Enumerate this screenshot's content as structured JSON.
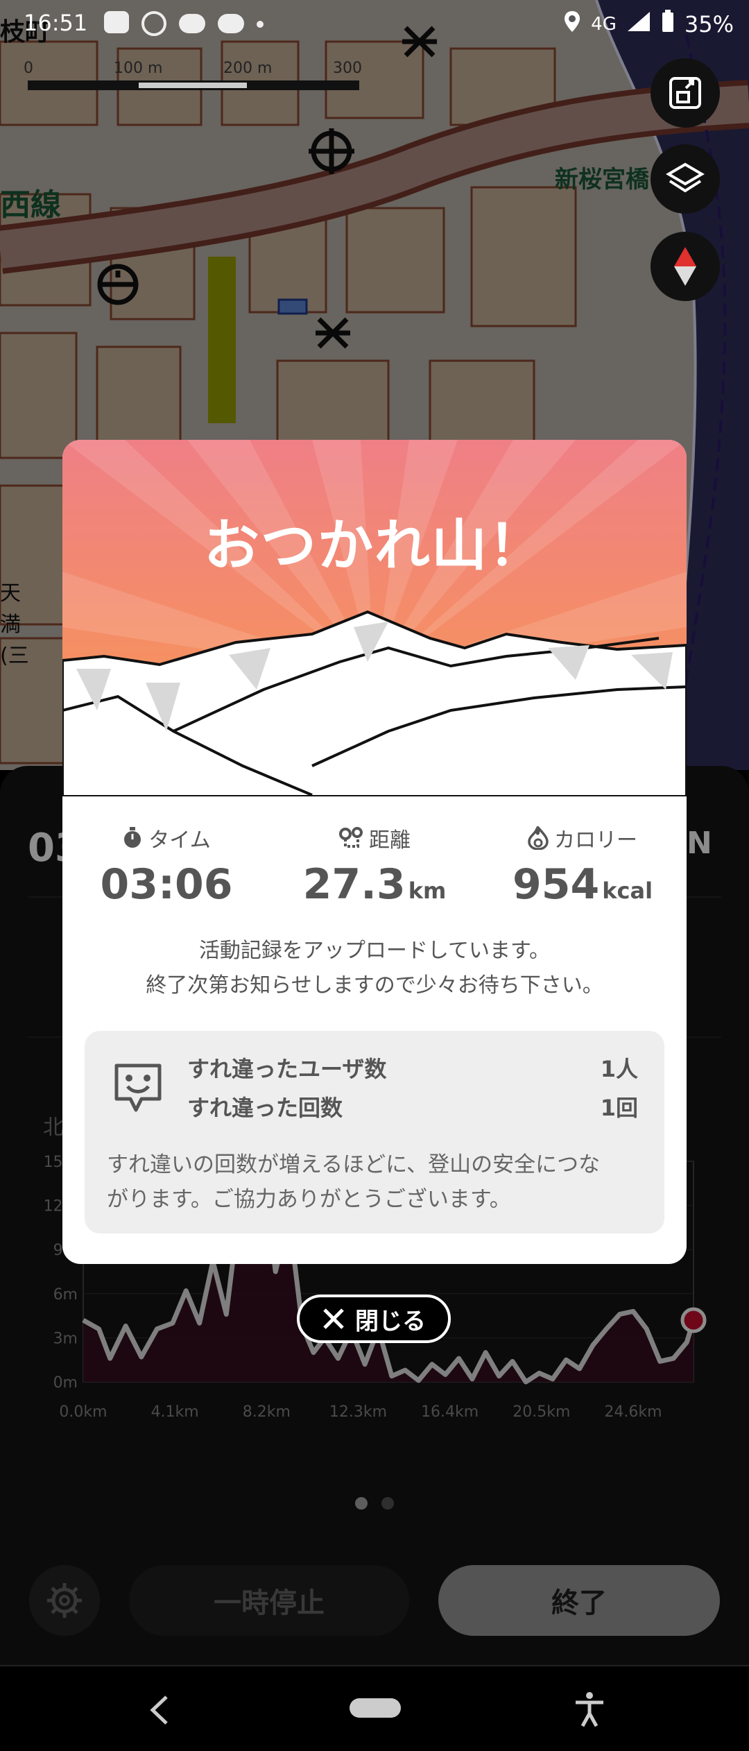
{
  "status_bar": {
    "time": "16:51",
    "network": "4G",
    "battery": "35%",
    "notification_icons": [
      "line-icon",
      "media-icon",
      "weather-icon",
      "cloud-icon",
      "dot-icon"
    ],
    "right_icons": [
      "location-icon",
      "signal-icon",
      "battery-icon"
    ]
  },
  "map": {
    "labels": {
      "top_left": "枝町",
      "line_name": "西線",
      "station": "新桜宮橋",
      "left_vertical_1": "天",
      "left_vertical_2": "満",
      "left_vertical_3": "(三"
    },
    "scale_labels": [
      "0",
      "100 m",
      "200 m",
      "300 m"
    ],
    "buttons": [
      "fit-route-icon",
      "layers-icon",
      "compass-icon"
    ]
  },
  "panel": {
    "left_partial": "03",
    "right_partial": "N",
    "chart_label_partial": "北"
  },
  "chart_data": {
    "type": "area",
    "x_ticks": [
      "0.0km",
      "4.1km",
      "8.2km",
      "12.3km",
      "16.4km",
      "20.5km",
      "24.6km"
    ],
    "y_ticks": [
      "0m",
      "3m",
      "6m",
      "9m",
      "12m",
      "15m"
    ],
    "ylim": [
      0,
      15
    ],
    "xlim": [
      0,
      27.3
    ],
    "x": [
      0,
      0.7,
      1.2,
      1.9,
      2.6,
      3.3,
      4.0,
      4.6,
      5.2,
      5.8,
      6.4,
      7.0,
      7.6,
      8.2,
      8.6,
      9.2,
      9.8,
      10.3,
      10.8,
      11.4,
      12.0,
      12.6,
      13.2,
      13.8,
      14.4,
      15.0,
      15.6,
      16.2,
      16.8,
      17.4,
      18.0,
      18.6,
      19.2,
      19.8,
      20.4,
      21.0,
      21.6,
      22.2,
      22.8,
      23.4,
      24.0,
      24.6,
      25.2,
      25.8,
      26.4,
      27.0,
      27.3
    ],
    "y": [
      4.2,
      3.6,
      1.6,
      3.8,
      1.7,
      3.6,
      4.0,
      6.2,
      4.0,
      8.2,
      4.6,
      12.0,
      9.5,
      12.5,
      7.5,
      11.3,
      3.8,
      2.0,
      3.0,
      1.6,
      3.5,
      1.2,
      3.6,
      0.4,
      0.8,
      0.1,
      1.2,
      0.5,
      1.6,
      0.2,
      2.0,
      0.4,
      1.4,
      0.0,
      0.6,
      0.2,
      1.5,
      0.9,
      2.5,
      3.6,
      4.6,
      4.8,
      3.6,
      1.4,
      1.6,
      2.7,
      4.2
    ],
    "series_color": "#e8e8e8",
    "fill_color": "#3a1020",
    "end_marker_color": "#c8102e",
    "grid": true
  },
  "pager": {
    "count": 2,
    "active": 0
  },
  "controls": {
    "settings_icon": "gear-icon",
    "pause_label": "一時停止",
    "end_label": "終了"
  },
  "modal": {
    "title": "おつかれ山！",
    "hero_colors": {
      "top": "#ef7f86",
      "bottom": "#f99a4c"
    },
    "stats": [
      {
        "icon": "stopwatch-icon",
        "label": "タイム",
        "value": "03:06",
        "unit": ""
      },
      {
        "icon": "route-pin-icon",
        "label": "距離",
        "value": "27.3",
        "unit": "km"
      },
      {
        "icon": "flame-icon",
        "label": "カロリー",
        "value": "954",
        "unit": "kcal"
      }
    ],
    "message_line1": "活動記録をアップロードしています。",
    "message_line2": "終了次第お知らせしますので少々お待ち下さい。",
    "pass": {
      "icon": "smile-chat-icon",
      "users_label": "すれ違ったユーザ数",
      "users_value": "1人",
      "times_label": "すれ違った回数",
      "times_value": "1回",
      "note_line1": "すれ違いの回数が増えるほどに、登山の安全につな",
      "note_line2": "がります。ご協力ありがとうございます。"
    }
  },
  "close_button": {
    "label": "閉じる",
    "icon": "close-x-icon"
  },
  "nav": {
    "back": "back-icon",
    "home": "home-pill",
    "accessibility": "accessibility-icon"
  }
}
